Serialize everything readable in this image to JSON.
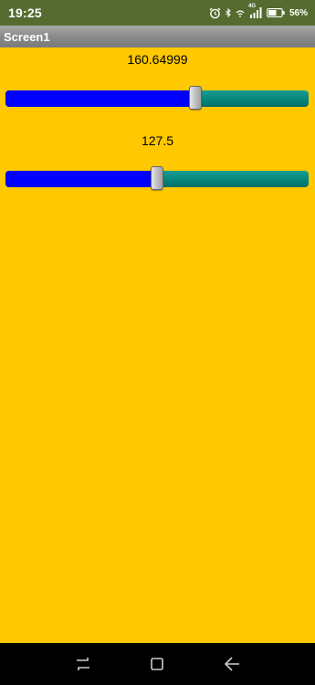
{
  "status_bar": {
    "time": "19:25",
    "network": "4G",
    "battery_percent": "56%",
    "icons": [
      "alarm-icon",
      "bluetooth-icon",
      "wifi-icon",
      "signal-icon",
      "battery-icon"
    ]
  },
  "title_bar": {
    "title": "Screen1"
  },
  "screen": {
    "background": "#ffc800"
  },
  "sliders": [
    {
      "label": "160.64999",
      "level_fraction": 0.625,
      "fill_color": "#0000ff",
      "track_color": "#04877c"
    },
    {
      "label": "127.5",
      "level_fraction": 0.5,
      "fill_color": "#0000ff",
      "track_color": "#04877c"
    }
  ],
  "nav_bar": {
    "icons": [
      "recent-apps-icon",
      "home-icon",
      "back-icon"
    ]
  }
}
